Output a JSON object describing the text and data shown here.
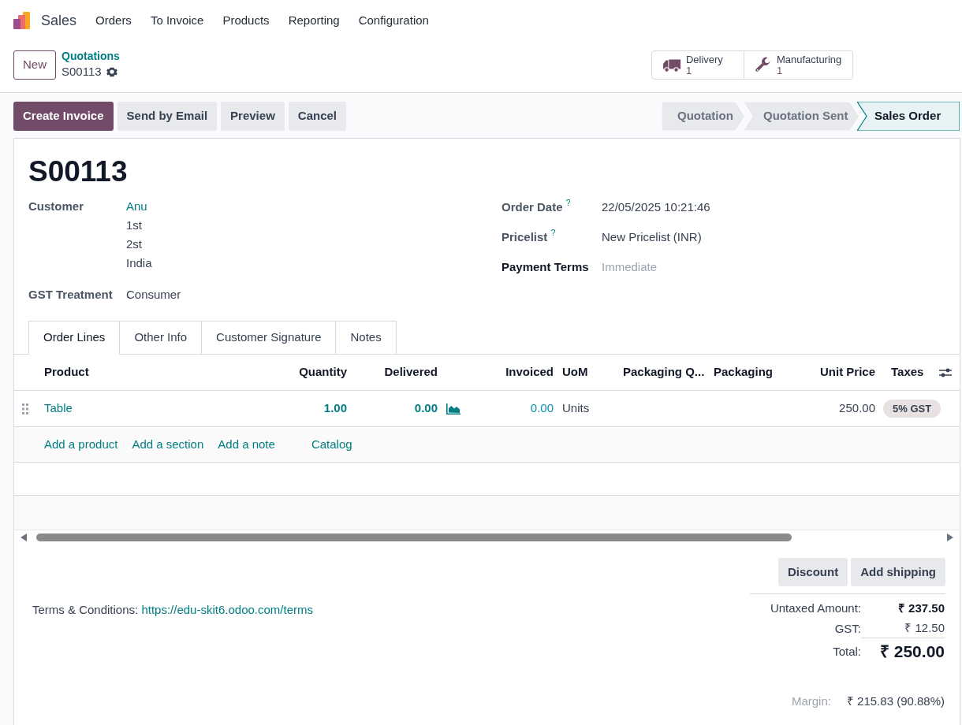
{
  "nav": {
    "app": "Sales",
    "menu": [
      "Orders",
      "To Invoice",
      "Products",
      "Reporting",
      "Configuration"
    ]
  },
  "control": {
    "new_button": "New",
    "breadcrumb": {
      "parent": "Quotations",
      "current": "S00113"
    },
    "smart_buttons": [
      {
        "kind": "delivery",
        "label": "Delivery",
        "count": "1"
      },
      {
        "kind": "manufacturing",
        "label": "Manufacturing",
        "count": "1"
      }
    ]
  },
  "actions": [
    {
      "label": "Create Invoice",
      "primary": true
    },
    {
      "label": "Send by Email",
      "primary": false
    },
    {
      "label": "Preview",
      "primary": false
    },
    {
      "label": "Cancel",
      "primary": false
    }
  ],
  "stages": [
    {
      "label": "Quotation",
      "selected": false
    },
    {
      "label": "Quotation Sent",
      "selected": false
    },
    {
      "label": "Sales Order",
      "selected": true
    }
  ],
  "form": {
    "title": "S00113",
    "left_fields": [
      {
        "label": "Customer",
        "value": "Anu",
        "link": true,
        "address": [
          "1st",
          "2st",
          "India"
        ]
      },
      {
        "label": "GST Treatment",
        "value": "Consumer",
        "link": false
      }
    ],
    "right_fields": [
      {
        "label": "Order Date",
        "help": "?",
        "bold": false,
        "value": "22/05/2025 10:21:46"
      },
      {
        "label": "Pricelist",
        "help": "?",
        "bold": false,
        "value": "New Pricelist (INR)"
      },
      {
        "label": "Payment Terms",
        "bold": true,
        "placeholder": "Immediate"
      }
    ]
  },
  "tabs": [
    {
      "label": "Order Lines",
      "selected": true
    },
    {
      "label": "Other Info",
      "selected": false
    },
    {
      "label": "Customer Signature",
      "selected": false
    },
    {
      "label": "Notes",
      "selected": false
    }
  ],
  "table": {
    "columns": [
      "Product",
      "Quantity",
      "Delivered",
      "Invoiced",
      "UoM",
      "Packaging Q...",
      "Packaging",
      "Unit Price",
      "Taxes"
    ],
    "rows": [
      {
        "product": "Table",
        "quantity": "1.00",
        "delivered": "0.00",
        "invoiced": "0.00",
        "uom": "Units",
        "unit_price": "250.00",
        "taxes": [
          "5% GST"
        ]
      }
    ],
    "add_links": [
      "Add a product",
      "Add a section",
      "Add a note",
      "Catalog"
    ]
  },
  "buttons": [
    "Discount",
    "Add shipping"
  ],
  "terms": {
    "label": "Terms & Conditions:",
    "link": "https://edu-skit6.odoo.com/terms"
  },
  "totals": [
    {
      "kind": "subtotal",
      "label": "Untaxed Amount:",
      "value": "₹ 237.50"
    },
    {
      "kind": "tax",
      "label": "GST:",
      "value": "₹ 12.50"
    },
    {
      "kind": "total",
      "label": "Total:",
      "value": "₹ 250.00"
    }
  ],
  "margin": {
    "label": "Margin:",
    "value": "₹ 215.83 (90.88%)"
  }
}
